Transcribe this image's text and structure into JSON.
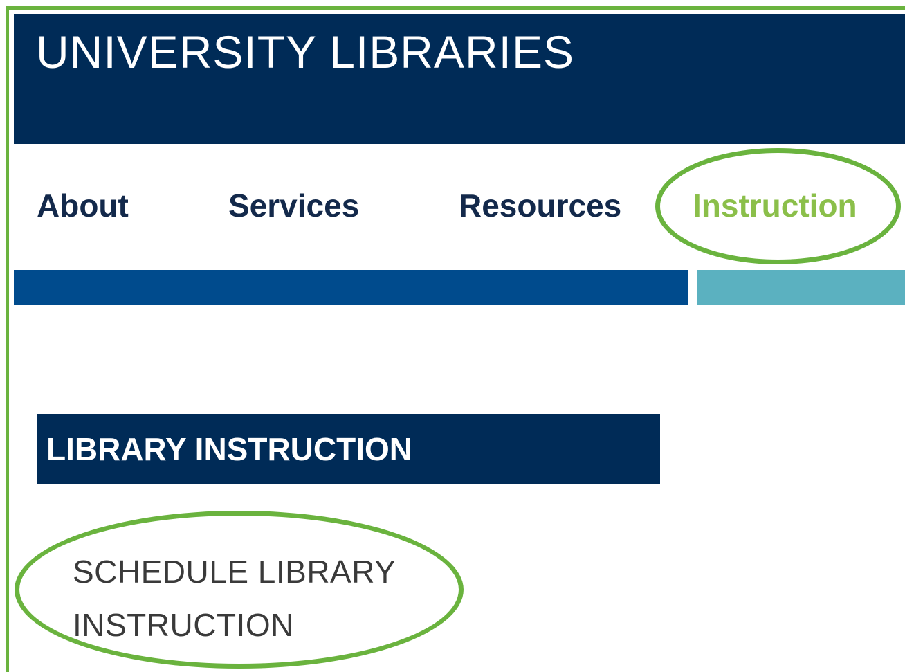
{
  "header": {
    "title": "UNIVERSITY LIBRARIES"
  },
  "nav": {
    "items": [
      {
        "label": "About"
      },
      {
        "label": "Services"
      },
      {
        "label": "Resources"
      },
      {
        "label": "Instruction",
        "active": true
      }
    ]
  },
  "section": {
    "heading": "LIBRARY INSTRUCTION",
    "link_line1": "SCHEDULE LIBRARY",
    "link_line2": "INSTRUCTION"
  },
  "colors": {
    "header_bg": "#002b57",
    "nav_text": "#13294b",
    "nav_active": "#8bbf4a",
    "bar_dark": "#004b8d",
    "bar_teal": "#5bb1c0",
    "highlight": "#6ab33e"
  }
}
